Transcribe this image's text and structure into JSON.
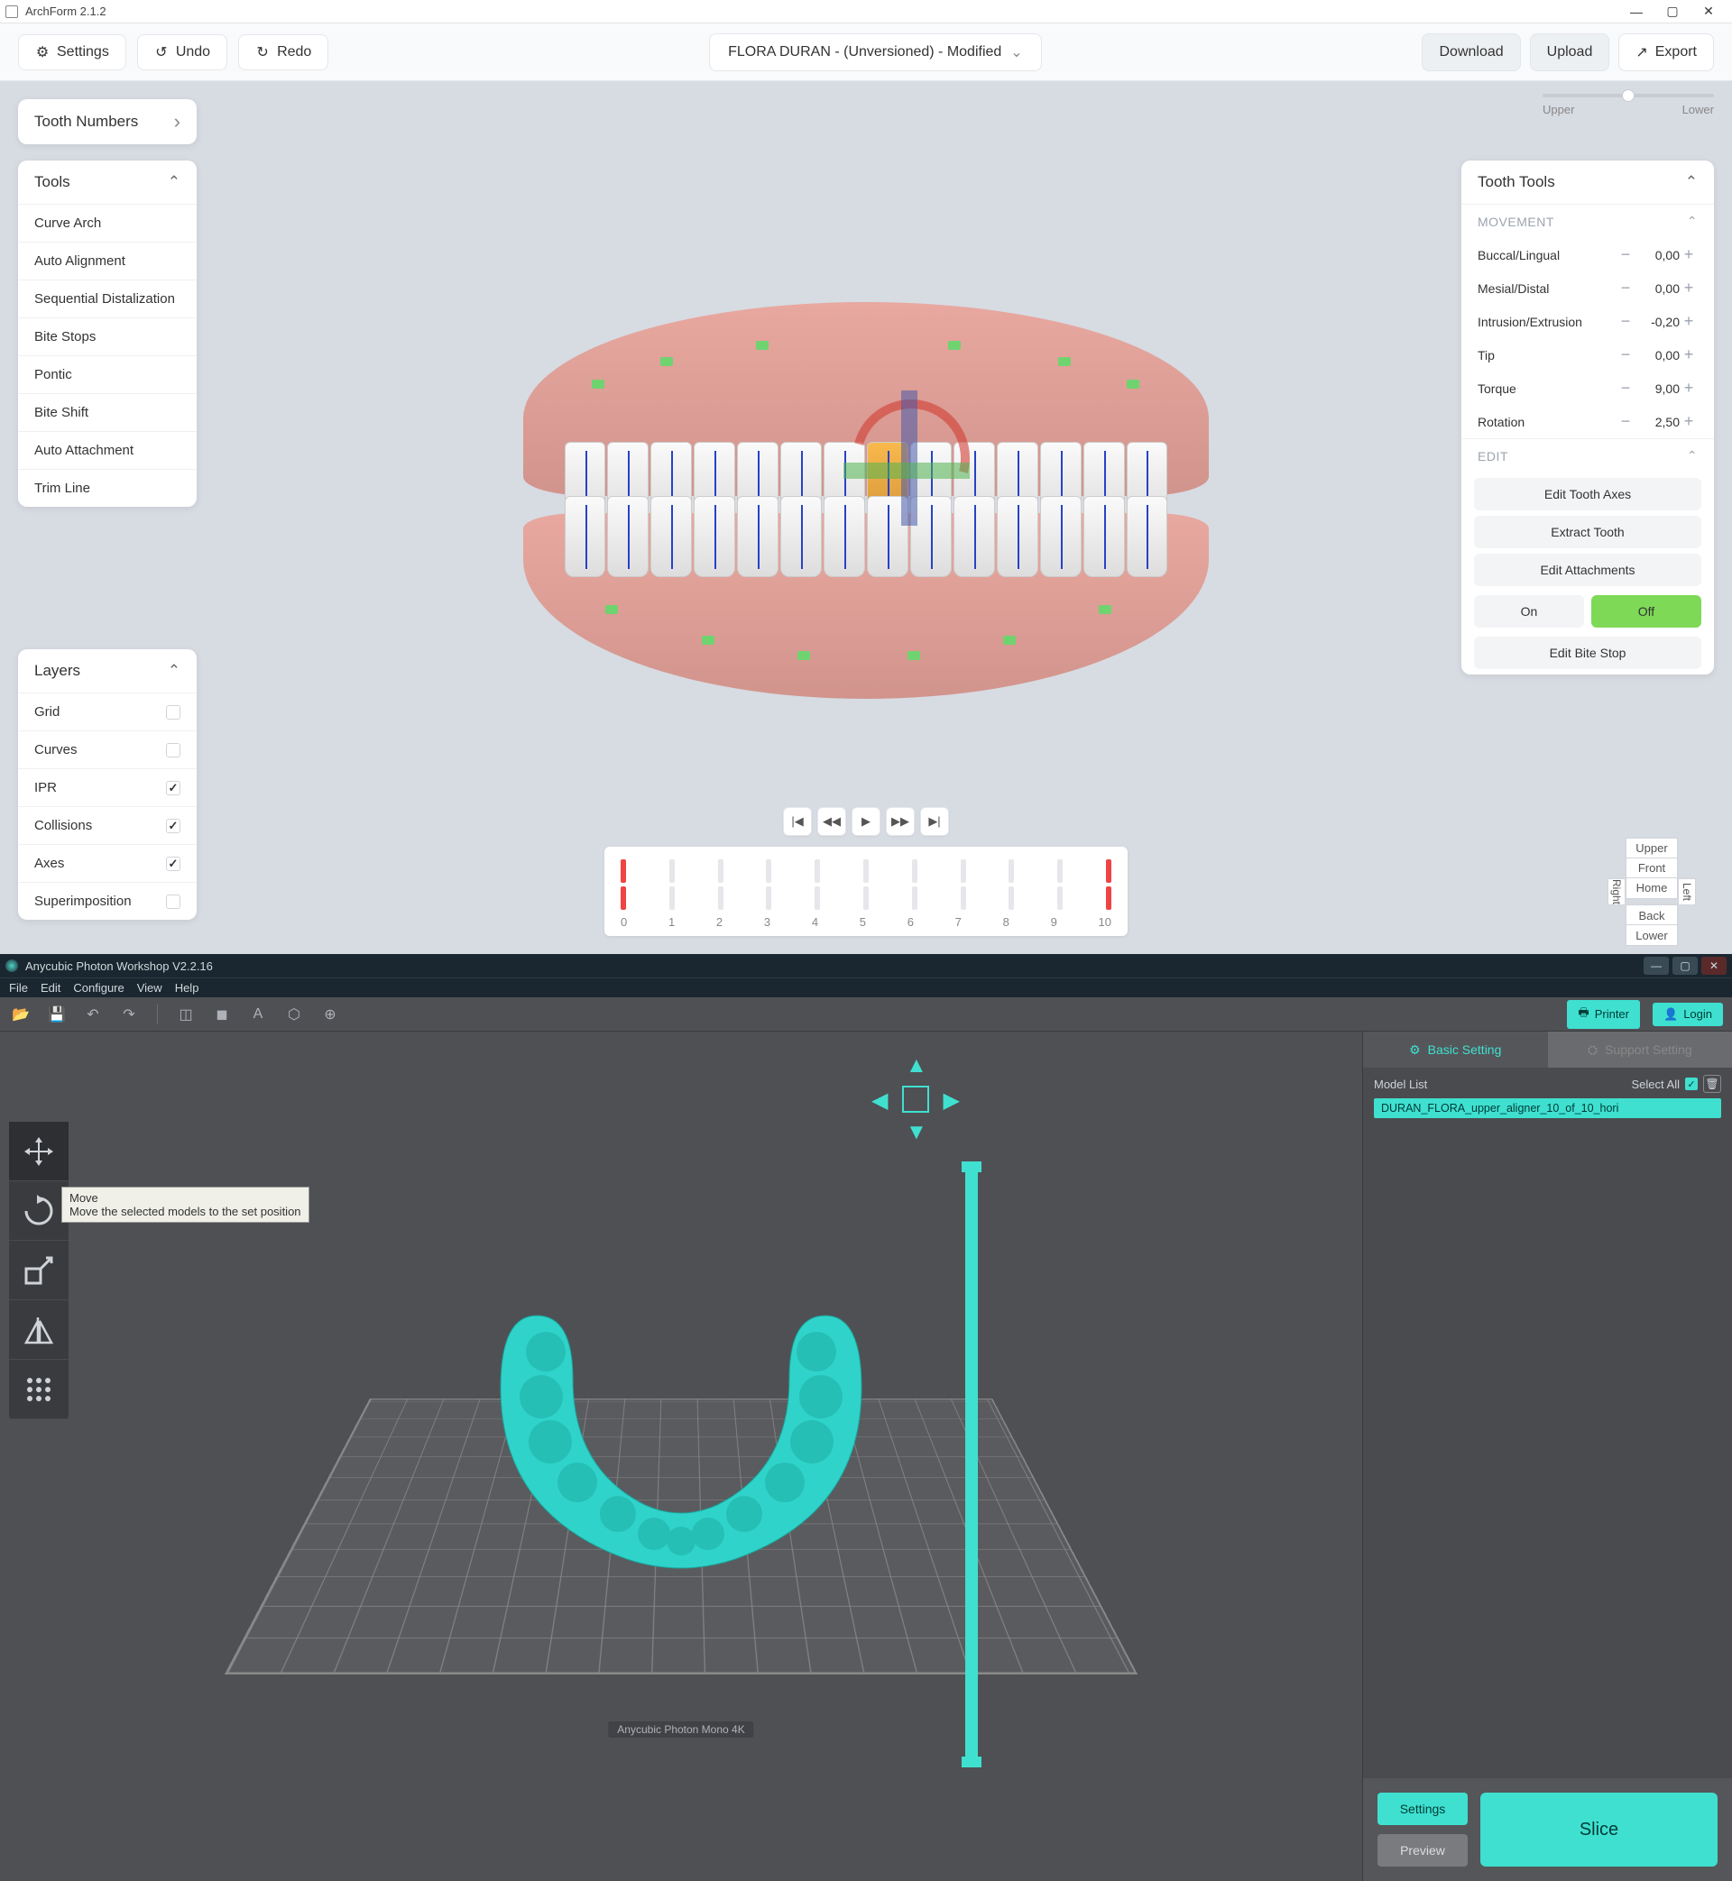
{
  "archform": {
    "title": "ArchForm 2.1.2",
    "toolbar": {
      "settings": "Settings",
      "undo": "Undo",
      "redo": "Redo",
      "project": "FLORA DURAN - (Unversioned) - Modified",
      "download": "Download",
      "upload": "Upload",
      "export": "Export"
    },
    "tooth_numbers": {
      "label": "Tooth Numbers"
    },
    "tools": {
      "title": "Tools",
      "items": [
        "Curve Arch",
        "Auto Alignment",
        "Sequential Distalization",
        "Bite Stops",
        "Pontic",
        "Bite Shift",
        "Auto Attachment",
        "Trim Line"
      ]
    },
    "layers": {
      "title": "Layers",
      "items": [
        {
          "label": "Grid",
          "checked": false
        },
        {
          "label": "Curves",
          "checked": false
        },
        {
          "label": "IPR",
          "checked": true
        },
        {
          "label": "Collisions",
          "checked": true
        },
        {
          "label": "Axes",
          "checked": true
        },
        {
          "label": "Superimposition",
          "checked": false
        }
      ]
    },
    "upper_lower": {
      "left": "Upper",
      "right": "Lower"
    },
    "tooth_tools": {
      "title": "Tooth Tools",
      "movement_label": "MOVEMENT",
      "movement": [
        {
          "label": "Buccal/Lingual",
          "value": "0,00"
        },
        {
          "label": "Mesial/Distal",
          "value": "0,00"
        },
        {
          "label": "Intrusion/Extrusion",
          "value": "-0,20"
        },
        {
          "label": "Tip",
          "value": "0,00"
        },
        {
          "label": "Torque",
          "value": "9,00"
        },
        {
          "label": "Rotation",
          "value": "2,50"
        }
      ],
      "edit_label": "EDIT",
      "edit_buttons": [
        "Edit Tooth Axes",
        "Extract Tooth",
        "Edit Attachments"
      ],
      "toggle": {
        "on": "On",
        "off": "Off"
      },
      "edit_bite_stop": "Edit Bite Stop"
    },
    "orientation": {
      "upper": "Upper",
      "front": "Front",
      "home": "Home",
      "back": "Back",
      "lower": "Lower",
      "right": "Right",
      "left": "Left"
    },
    "timeline": {
      "labels": [
        "0",
        "1",
        "2",
        "3",
        "4",
        "5",
        "6",
        "7",
        "8",
        "9",
        "10"
      ]
    }
  },
  "photon": {
    "title": "Anycubic Photon Workshop V2.2.16",
    "menu": [
      "File",
      "Edit",
      "Configure",
      "View",
      "Help"
    ],
    "top_buttons": {
      "printer": "Printer",
      "login": "Login"
    },
    "tabs": {
      "basic": "Basic Setting",
      "support": "Support Setting"
    },
    "modellist": {
      "title": "Model List",
      "select_all": "Select All",
      "item": "DURAN_FLORA_upper_aligner_10_of_10_hori"
    },
    "tooltip": {
      "title": "Move",
      "desc": "Move the selected models to the set position"
    },
    "plate_label": "Anycubic Photon Mono 4K",
    "footer": {
      "settings": "Settings",
      "preview": "Preview",
      "slice": "Slice"
    }
  }
}
